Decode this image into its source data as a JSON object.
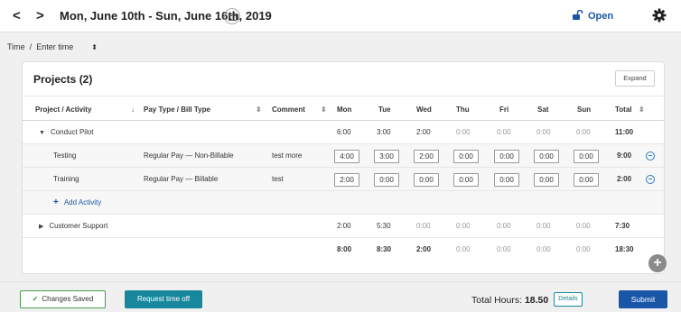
{
  "header": {
    "prev": "<",
    "next": ">",
    "date_range": "Mon, June 10th - Sun, June 16th, 2019",
    "status": "Open"
  },
  "filter": {
    "label": "Time",
    "separator": "/",
    "value": "Enter time",
    "caret": "⬍"
  },
  "projects": {
    "title": "Projects (2)",
    "expand_label": "Expand"
  },
  "columns": {
    "project": "Project / Activity",
    "pay": "Pay Type / Bill Type",
    "comment": "Comment",
    "days": [
      "Mon",
      "Tue",
      "Wed",
      "Thu",
      "Fri",
      "Sat",
      "Sun"
    ],
    "total": "Total"
  },
  "rows": {
    "conduct": {
      "name": "Conduct Pilot",
      "hours": [
        "6:00",
        "3:00",
        "2:00",
        "0:00",
        "0:00",
        "0:00",
        "0:00"
      ],
      "total": "11:00"
    },
    "testing": {
      "name": "Testing",
      "pay": "Regular Pay — Non-Billable",
      "comment": "test more",
      "hours": [
        "4:00",
        "3:00",
        "2:00",
        "0:00",
        "0:00",
        "0:00",
        "0:00"
      ],
      "total": "9:00"
    },
    "training": {
      "name": "Training",
      "pay": "Regular Pay — Billable",
      "comment": "test",
      "hours": [
        "2:00",
        "0:00",
        "0:00",
        "0:00",
        "0:00",
        "0:00",
        "0:00"
      ],
      "total": "2:00"
    },
    "add_activity": "Add Activity",
    "customer": {
      "name": "Customer Support",
      "hours": [
        "2:00",
        "5:30",
        "0:00",
        "0:00",
        "0:00",
        "0:00",
        "0:00"
      ],
      "total": "7:30"
    },
    "totals": {
      "hours": [
        "8:00",
        "8:30",
        "2:00",
        "0:00",
        "0:00",
        "0:00",
        "0:00"
      ],
      "total": "18:30"
    }
  },
  "footer": {
    "saved_label": "Changes Saved",
    "timeoff_label": "Request time off",
    "total_hours_label": "Total Hours:",
    "total_hours_value": "18.50",
    "details_label": "Details",
    "submit_label": "Submit"
  },
  "colors": {
    "accent": "#1a56a8",
    "teal": "#17879c",
    "success": "#4a9a4a"
  }
}
